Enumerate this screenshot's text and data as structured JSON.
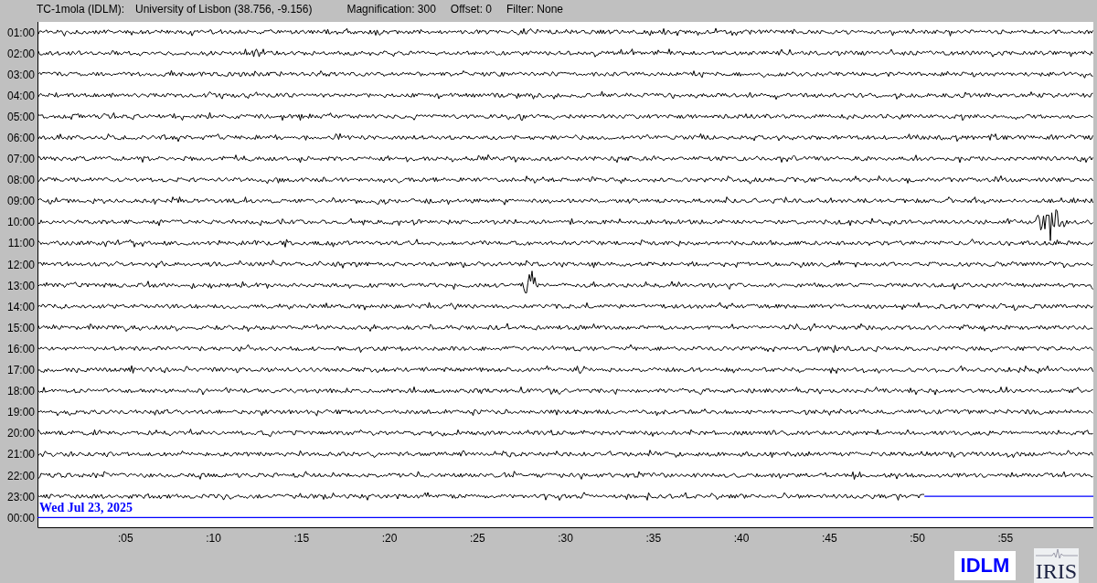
{
  "header": {
    "station": "TC-1mola (IDLM):",
    "location": "University of Lisbon (38.756, -9.156)",
    "magnification": "Magnification: 300",
    "offset": "Offset: 0",
    "filter": "Filter: None"
  },
  "rows": [
    {
      "label": "01:00",
      "kind": "full"
    },
    {
      "label": "02:00",
      "kind": "full"
    },
    {
      "label": "03:00",
      "kind": "full"
    },
    {
      "label": "04:00",
      "kind": "full"
    },
    {
      "label": "05:00",
      "kind": "full"
    },
    {
      "label": "06:00",
      "kind": "full"
    },
    {
      "label": "07:00",
      "kind": "full"
    },
    {
      "label": "08:00",
      "kind": "full"
    },
    {
      "label": "09:00",
      "kind": "full"
    },
    {
      "label": "10:00",
      "kind": "full"
    },
    {
      "label": "11:00",
      "kind": "full"
    },
    {
      "label": "12:00",
      "kind": "full"
    },
    {
      "label": "13:00",
      "kind": "full"
    },
    {
      "label": "14:00",
      "kind": "full"
    },
    {
      "label": "15:00",
      "kind": "full"
    },
    {
      "label": "16:00",
      "kind": "full"
    },
    {
      "label": "17:00",
      "kind": "full"
    },
    {
      "label": "18:00",
      "kind": "full"
    },
    {
      "label": "19:00",
      "kind": "full"
    },
    {
      "label": "20:00",
      "kind": "full"
    },
    {
      "label": "21:00",
      "kind": "full"
    },
    {
      "label": "22:00",
      "kind": "full"
    },
    {
      "label": "23:00",
      "kind": "partial",
      "level": 0.84
    },
    {
      "label": "00:00",
      "kind": "empty"
    }
  ],
  "date_label": "Wed Jul 23, 2025",
  "x_ticks": [
    ":05",
    ":10",
    ":15",
    ":20",
    ":25",
    ":30",
    ":35",
    ":40",
    ":45",
    ":50",
    ":55"
  ],
  "logos": {
    "station": "IDLM",
    "network": "IRIS"
  }
}
